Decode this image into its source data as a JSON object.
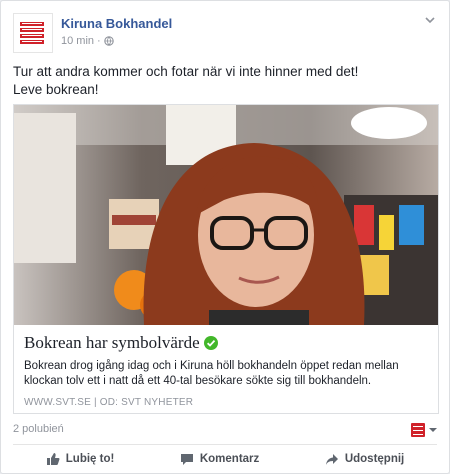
{
  "post": {
    "page_name": "Kiruna Bokhandel",
    "time": "10 min",
    "separator": "·",
    "text_line1": "Tur att andra kommer och fotar när vi inte hinner med det!",
    "text_line2": "Leve bokrean!"
  },
  "link": {
    "title": "Bokrean har symbolvärde",
    "description": "Bokrean drog igång idag och i Kiruna höll bokhandeln öppet redan mellan klockan tolv ett i natt då ett 40-tal besökare sökte sig till bokhandeln.",
    "source": "WWW.SVT.SE",
    "source_sep": "|",
    "author": "OD: SVT NYHETER"
  },
  "stats": {
    "likes": "2 polubień"
  },
  "actions": {
    "like": "Lubię to!",
    "comment": "Komentarz",
    "share": "Udostępnij"
  },
  "colors": {
    "accent": "#365899",
    "logo_red": "#d0222a",
    "verified": "#42b72a"
  }
}
